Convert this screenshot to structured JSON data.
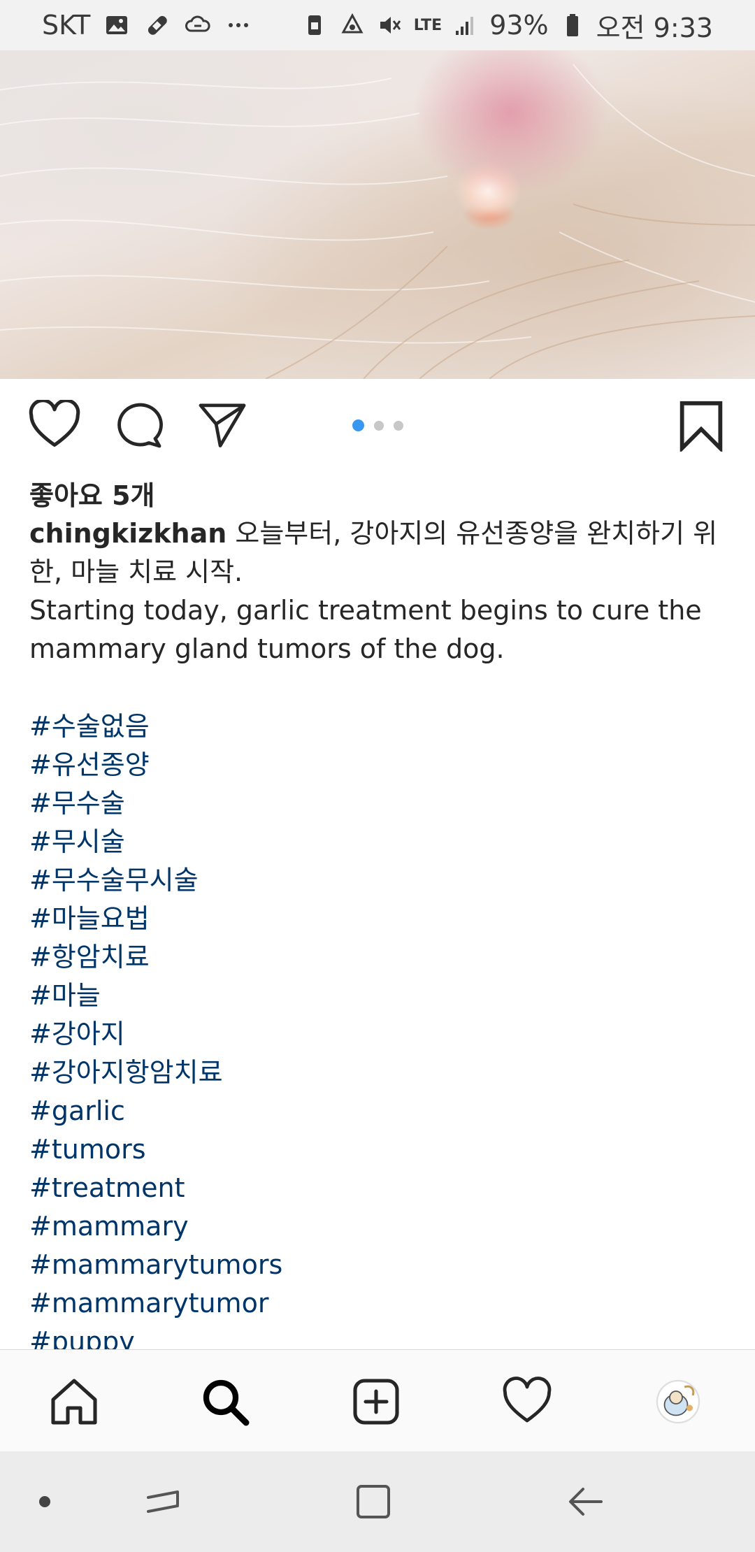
{
  "status_bar": {
    "carrier": "SKT",
    "left_icons": [
      "image-icon",
      "bandage-icon",
      "cloud-sync-icon",
      "more-dots-icon"
    ],
    "network_label": "LTE",
    "battery_percent": "93%",
    "time": "오전 9:33",
    "right_icons": [
      "nfc-icon",
      "recycle-icon",
      "mute-icon",
      "signal-icon",
      "battery-icon"
    ]
  },
  "post": {
    "image_alt": "",
    "carousel": {
      "count": 3,
      "active_index": 0
    },
    "likes": "좋아요 5개",
    "username": "chingkizkhan",
    "caption_ko": "오늘부터, 강아지의 유선종양을 완치하기 위한, 마늘 치료 시작.",
    "caption_en": "Starting today, garlic treatment begins to cure the mammary gland tumors of the dog.",
    "hashtags": [
      "#수술없음",
      "#유선종양",
      "#무수술",
      "#무시술",
      "#무수술무시술",
      "#마늘요법",
      "#항암치료",
      "#마늘",
      "#강아지",
      "#강아지항암치료",
      "#garlic",
      "#tumors",
      "#treatment",
      "#mammary",
      "#mammarytumors",
      "#mammarytumor",
      "#puppy"
    ]
  },
  "actions": {
    "icons": [
      "heart-icon",
      "comment-icon",
      "share-icon",
      "bookmark-icon"
    ]
  },
  "bottom_nav": {
    "items": [
      "home-icon",
      "search-icon",
      "add-post-icon",
      "activity-heart-icon",
      "profile-avatar"
    ]
  },
  "system_nav": {
    "items": [
      "dot-indicator",
      "recent-apps-icon",
      "home-square-icon",
      "back-arrow-icon"
    ]
  },
  "colors": {
    "hashtag": "#003569",
    "text": "#262626",
    "dot_active": "#3897f0",
    "dot_inactive": "#c7c7c7"
  }
}
